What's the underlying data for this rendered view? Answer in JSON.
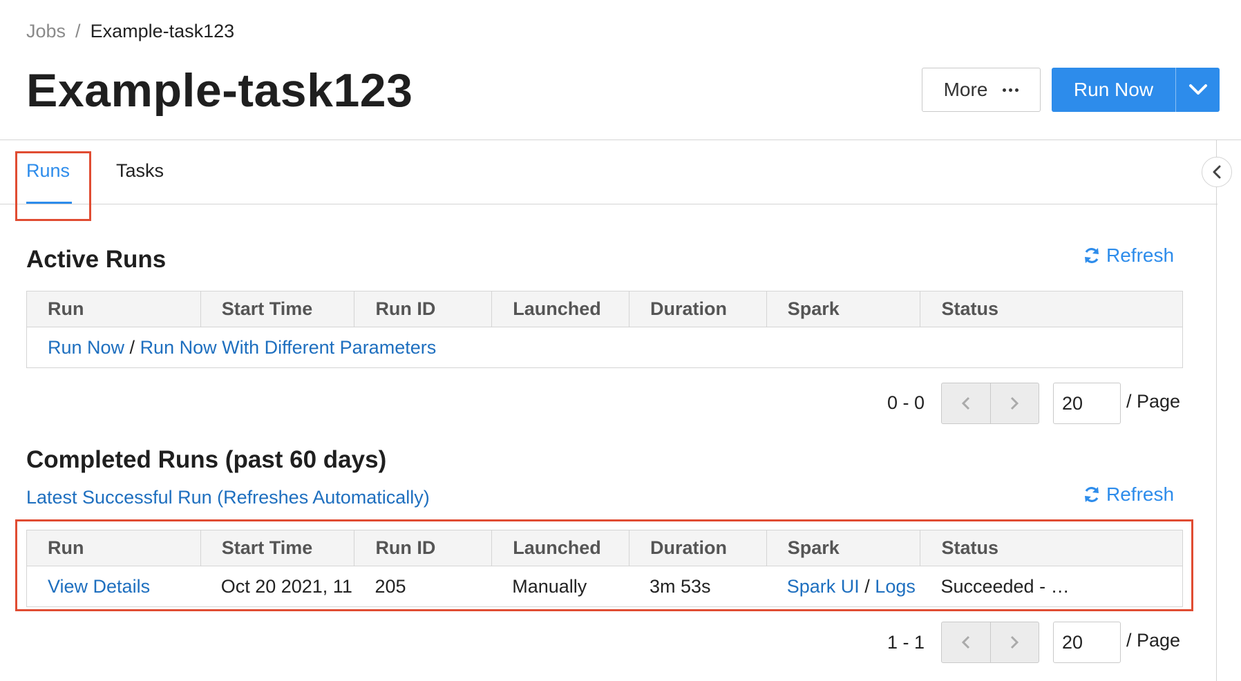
{
  "breadcrumb": {
    "root": "Jobs",
    "separator": "/",
    "current": "Example-task123"
  },
  "page_title": "Example-task123",
  "header_buttons": {
    "more_label": "More",
    "run_now_label": "Run Now"
  },
  "tabs": [
    {
      "label": "Runs",
      "active": true
    },
    {
      "label": "Tasks",
      "active": false
    }
  ],
  "active_runs": {
    "title": "Active Runs",
    "refresh_label": "Refresh",
    "columns": [
      "Run",
      "Start Time",
      "Run ID",
      "Launched",
      "Duration",
      "Spark",
      "Status"
    ],
    "empty_row": {
      "run_now": "Run Now",
      "separator": " / ",
      "run_with_params": "Run Now With Different Parameters"
    },
    "pager": {
      "range": "0 - 0",
      "page_size": "20",
      "per_page_label": "/ Page"
    }
  },
  "completed_runs": {
    "title": "Completed Runs (past 60 days)",
    "latest_link": "Latest Successful Run (Refreshes Automatically)",
    "refresh_label": "Refresh",
    "columns": [
      "Run",
      "Start Time",
      "Run ID",
      "Launched",
      "Duration",
      "Spark",
      "Status"
    ],
    "rows": [
      {
        "run": "View Details",
        "start_time": "Oct 20 2021, 11…",
        "run_id": "205",
        "launched": "Manually",
        "duration": "3m 53s",
        "spark_ui": "Spark UI",
        "spark_sep": " / ",
        "spark_logs": "Logs …",
        "status": "Succeeded - …"
      }
    ],
    "pager": {
      "range": "1 - 1",
      "page_size": "20",
      "per_page_label": "/ Page"
    }
  },
  "colors": {
    "accent": "#2d8ceb",
    "link": "#1e6fbf",
    "highlight": "#e04c32"
  },
  "icons": [
    "more-dots-icon",
    "chevron-down-icon",
    "chevron-left-icon",
    "refresh-icon",
    "chevron-right-icon"
  ]
}
